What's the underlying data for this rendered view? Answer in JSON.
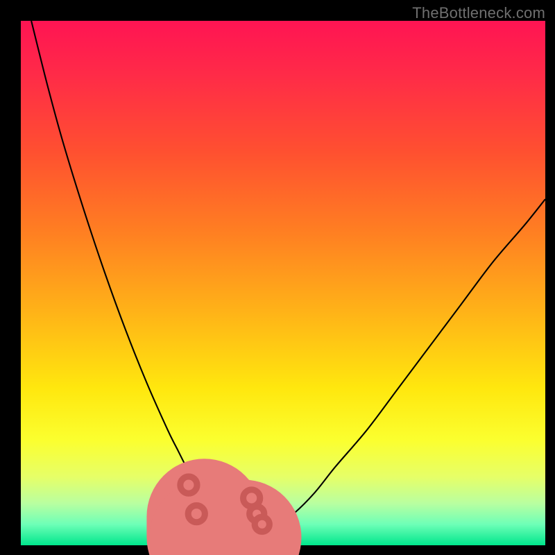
{
  "watermark": "TheBottleneck.com",
  "chart_data": {
    "type": "line",
    "title": "",
    "xlabel": "",
    "ylabel": "",
    "xlim": [
      0,
      100
    ],
    "ylim": [
      0,
      100
    ],
    "grid": false,
    "legend": false,
    "series": [
      {
        "name": "curve",
        "x": [
          2,
          5,
          8,
          12,
          16,
          20,
          24,
          28,
          30,
          32,
          34,
          36,
          38,
          40,
          44,
          48,
          52,
          56,
          60,
          66,
          72,
          78,
          84,
          90,
          96,
          100
        ],
        "values": [
          100,
          88,
          77,
          64,
          52,
          41,
          31,
          22,
          18,
          14,
          10,
          6,
          3,
          1,
          1,
          3,
          6,
          10,
          15,
          22,
          30,
          38,
          46,
          54,
          61,
          66
        ]
      }
    ],
    "markers": {
      "dots": [
        {
          "x": 32.0,
          "y": 11.5,
          "r": 1.6
        },
        {
          "x": 33.5,
          "y": 6.0,
          "r": 1.6
        },
        {
          "x": 44.0,
          "y": 9.0,
          "r": 1.6
        },
        {
          "x": 45.0,
          "y": 6.0,
          "r": 1.4
        },
        {
          "x": 46.0,
          "y": 4.0,
          "r": 1.4
        }
      ],
      "bar": {
        "x1": 35.5,
        "y1": 1.5,
        "x2": 42.5,
        "y2": 1.5
      },
      "vstub": {
        "x": 35.0,
        "y1": 1.5,
        "y2": 5.5
      }
    },
    "colors": {
      "curve": "#000000",
      "markers": "#e77b79",
      "gradient_top": "#ff1453",
      "gradient_bottom": "#00e68c"
    }
  }
}
